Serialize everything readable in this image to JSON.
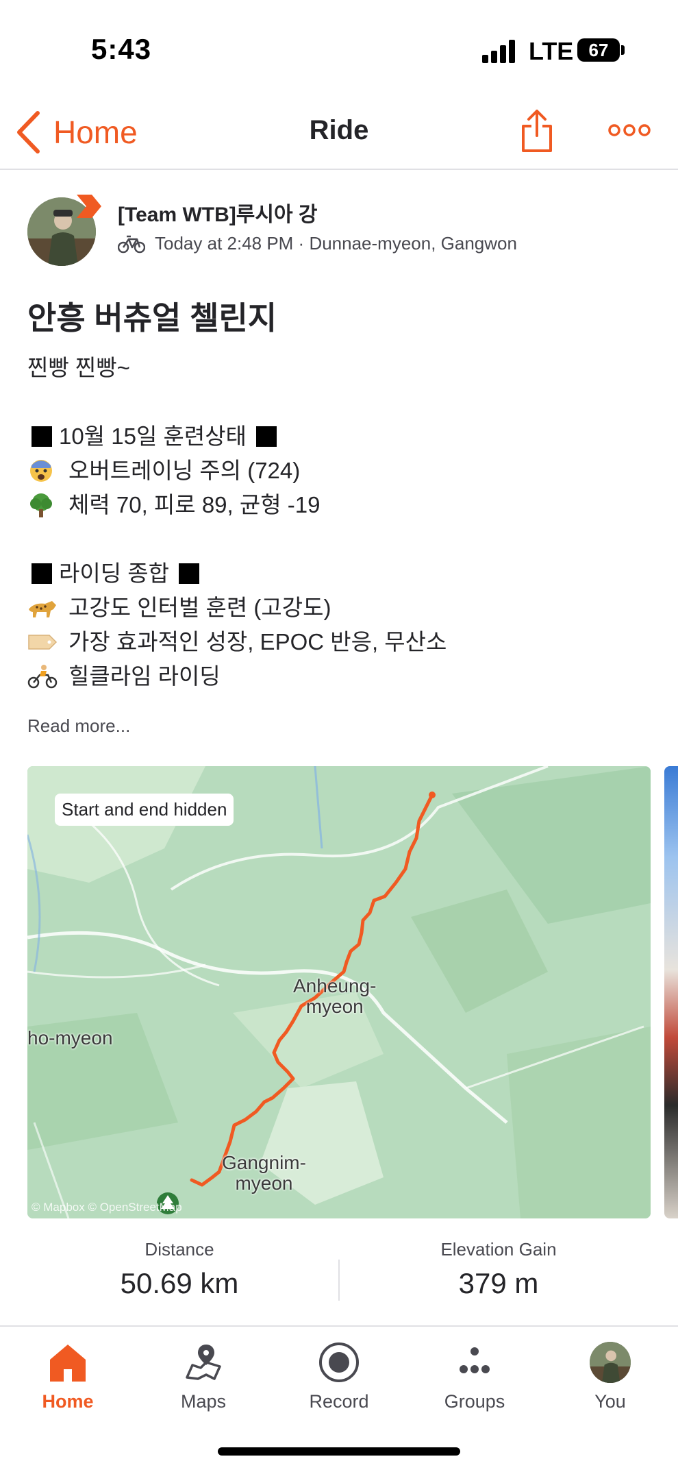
{
  "status_bar": {
    "time": "5:43",
    "network": "LTE",
    "battery": "67"
  },
  "header": {
    "back_label": "Home",
    "title": "Ride"
  },
  "athlete": {
    "name": "[Team WTB]루시아 강",
    "meta": "Today at 2:48 PM · Dunnae-myeon, Gangwon"
  },
  "activity": {
    "title": "안흥 버츄얼 첼린지",
    "description": {
      "greeting": "찐빵 찐빵~",
      "section1_title": "10월 15일 훈련상태",
      "line1": "오버트레이닝 주의 (724)",
      "line2": "체력 70, 피로 89, 균형 -19",
      "section2_title": "라이딩 종합",
      "line3": "고강도 인터벌 훈련 (고강도)",
      "line4": "가장 효과적인 성장, EPOC 반응, 무산소",
      "line5": "힐클라임 라이딩"
    },
    "read_more": "Read more..."
  },
  "map": {
    "badge": "Start and end hidden",
    "labels": {
      "place1_line1": "Anheung-",
      "place1_line2": "myeon",
      "place2": "ho-myeon",
      "place3_line1": "Gangnim-",
      "place3_line2": "myeon"
    },
    "credit": "© Mapbox © OpenStreetMap",
    "route_color": "#f05a22"
  },
  "stats": [
    {
      "label": "Distance",
      "value": "50.69 km"
    },
    {
      "label": "Elevation Gain",
      "value": "379 m"
    }
  ],
  "tabs": [
    {
      "label": "Home",
      "icon": "home-icon",
      "active": true
    },
    {
      "label": "Maps",
      "icon": "map-icon"
    },
    {
      "label": "Record",
      "icon": "record-icon"
    },
    {
      "label": "Groups",
      "icon": "groups-icon"
    },
    {
      "label": "You",
      "icon": "avatar"
    }
  ],
  "colors": {
    "accent": "#f05a22",
    "text": "#242428",
    "muted": "#494950"
  }
}
